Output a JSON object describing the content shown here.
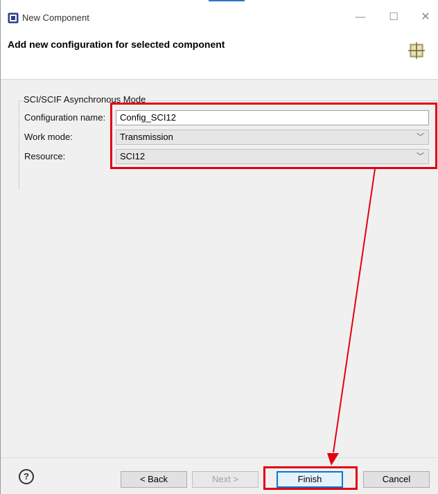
{
  "window": {
    "title": "New Component",
    "header_title": "Add new configuration for selected component"
  },
  "icons": {
    "app": "component-app-icon",
    "header": "component-grid-icon",
    "help": "help-icon"
  },
  "group": {
    "label": "SCI/SCIF Asynchronous Mode",
    "configuration_name_label": "Configuration name:",
    "configuration_name_value": "Config_SCI12",
    "work_mode_label": "Work mode:",
    "work_mode_value": "Transmission",
    "resource_label": "Resource:",
    "resource_value": "SCI12"
  },
  "footer": {
    "help_glyph": "?",
    "back_label": "< Back",
    "next_label": "Next >",
    "finish_label": "Finish",
    "cancel_label": "Cancel"
  },
  "colors": {
    "annotation_red": "#e3000f",
    "accent_blue": "#0078d7"
  }
}
